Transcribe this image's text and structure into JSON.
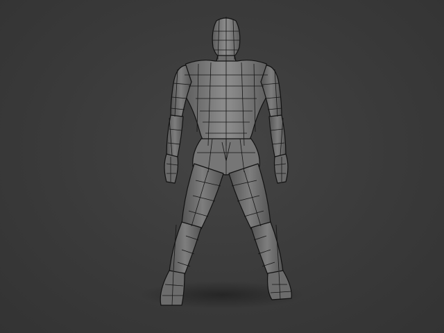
{
  "scene": {
    "subject": "wireframe-humanoid-base-mesh",
    "background_color": "#3b3b3b",
    "mesh_fill_color": "#7a7a7a",
    "mesh_shade_color": "#5a5a5a",
    "wire_color": "#111111"
  }
}
